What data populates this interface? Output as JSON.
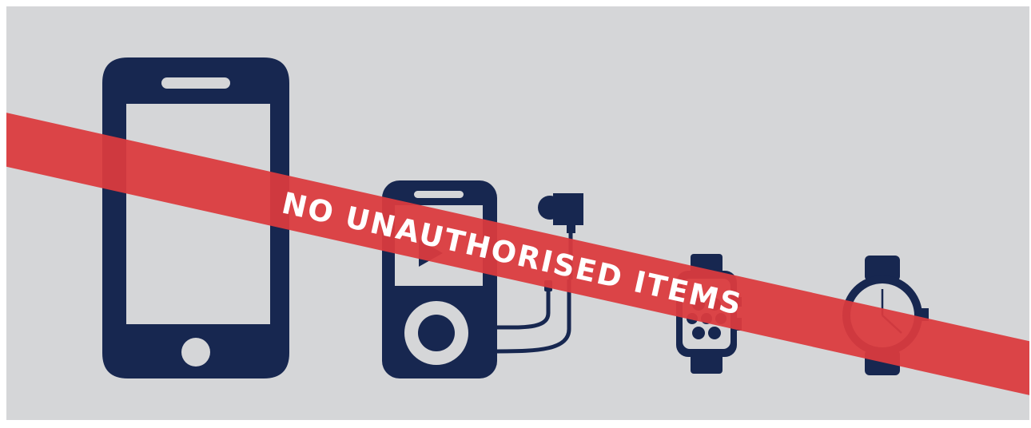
{
  "banner": {
    "text": "NO UNAUTHORISED ITEMS"
  },
  "items": [
    {
      "name": "smartphone",
      "icon": "smartphone-icon"
    },
    {
      "name": "media-player",
      "icon": "media-player-with-earphones-icon"
    },
    {
      "name": "smartwatch",
      "icon": "smartwatch-icon"
    },
    {
      "name": "wristwatch",
      "icon": "analog-watch-icon"
    }
  ],
  "colors": {
    "background": "#d5d6d8",
    "icon": "#172750",
    "banner": "#db3a3e",
    "banner_text": "#ffffff"
  }
}
